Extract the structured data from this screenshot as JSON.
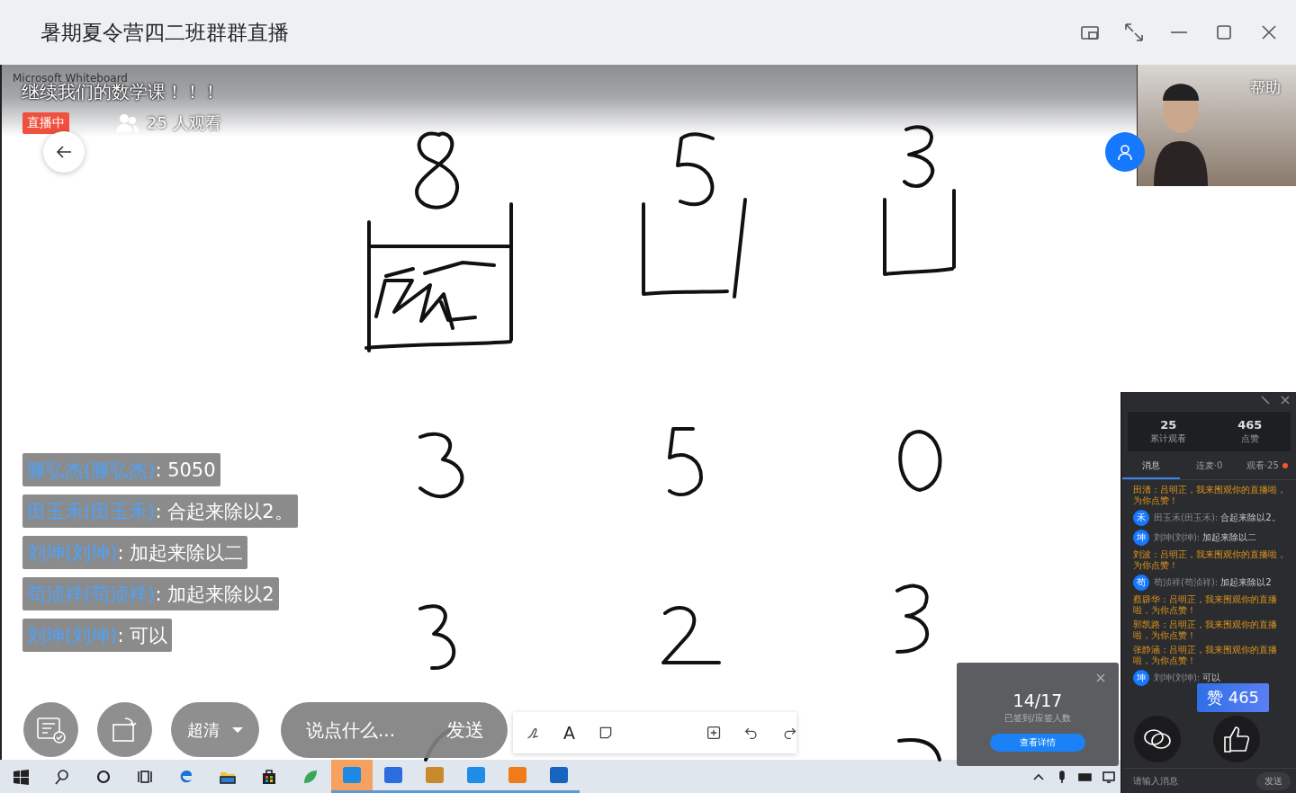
{
  "window": {
    "title": "暑期夏令营四二班群群直播"
  },
  "whiteboard": {
    "app_name": "Microsoft Whiteboard",
    "text_tool": "A"
  },
  "stream": {
    "title": "继续我们的数学课！！！",
    "live_badge": "直播中",
    "viewers": "25 人观看"
  },
  "camera": {
    "label": "帮助"
  },
  "danmaku": [
    {
      "name": "滕弘杰(滕弘杰)",
      "text": " : 5050"
    },
    {
      "name": "田玉禾(田玉禾)",
      "text": " : 合起来除以2。"
    },
    {
      "name": "刘坤(刘坤)",
      "text": " : 加起来除以二"
    },
    {
      "name": "苟浈祥(苟浈祥)",
      "text": " : 加起来除以2"
    },
    {
      "name": "刘坤(刘坤)",
      "text": " : 可以"
    }
  ],
  "controls": {
    "quality": "超清",
    "comment_placeholder": "说点什么...",
    "send": "发送"
  },
  "sign_in": {
    "count": "14/17",
    "caption": "已签到/应签人数",
    "button": "查看详情"
  },
  "panel": {
    "stats": [
      {
        "value": "25",
        "label": "累计观看"
      },
      {
        "value": "465",
        "label": "点赞"
      }
    ],
    "tabs": [
      {
        "label": "消息",
        "selected": true,
        "notify": false
      },
      {
        "label": "连麦·0",
        "selected": false,
        "notify": false
      },
      {
        "label": "观看·25",
        "selected": false,
        "notify": true
      }
    ],
    "messages": [
      {
        "kind": "system",
        "text": "田清：吕明正，我来围观你的直播啦，为你点赞！"
      },
      {
        "kind": "chat",
        "avatar": "禾",
        "name": "田玉禾(田玉禾):",
        "text": "合起来除以2。"
      },
      {
        "kind": "chat",
        "avatar": "坤",
        "name": "刘坤(刘坤):",
        "text": "加起来除以二"
      },
      {
        "kind": "system",
        "text": "刘波：吕明正，我来围观你的直播啦，为你点赞！"
      },
      {
        "kind": "chat",
        "avatar": "苟",
        "name": "苟浈祥(苟浈祥):",
        "text": "加起来除以2"
      },
      {
        "kind": "system",
        "text": "蔡辟华：吕明正，我来围观你的直播啦，为你点赞！"
      },
      {
        "kind": "system",
        "text": "郭凯路：吕明正，我来围观你的直播啦，为你点赞！"
      },
      {
        "kind": "system",
        "text": "张静涵：吕明正，我来围观你的直播啦，为你点赞！"
      },
      {
        "kind": "chat",
        "avatar": "坤",
        "name": "刘坤(刘坤):",
        "text": "可以"
      }
    ],
    "likes": "赞 465",
    "input_placeholder": "请输入消息",
    "send": "发送"
  }
}
